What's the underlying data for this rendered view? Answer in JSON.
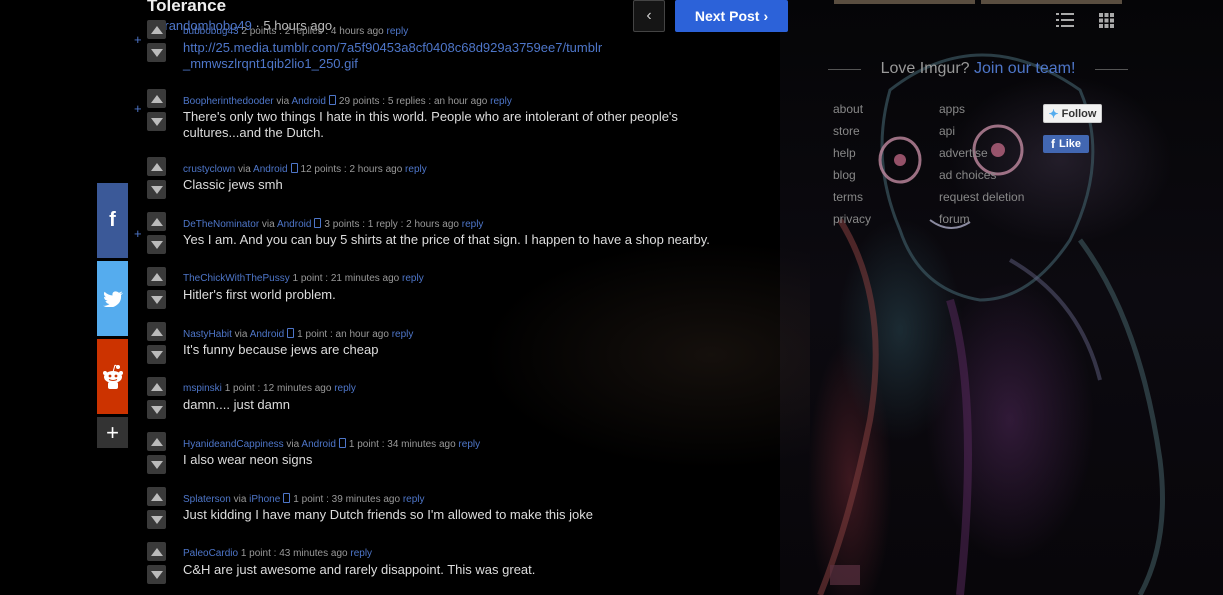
{
  "post": {
    "title": "Tolerance",
    "by": "by",
    "author": "randomhobo49",
    "age": " · 5 hours ago"
  },
  "nav": {
    "prev_glyph": "‹",
    "next_label": "Next Post"
  },
  "share": {
    "facebook_glyph": "f",
    "more_glyph": "+"
  },
  "comments": [
    {
      "user": "bubbobug43",
      "platform": "",
      "points": "2 points",
      "replies": " : 2 replies",
      "age": " : 4 hours ago",
      "reply": "reply",
      "text": "",
      "link": "http://25.media.tumblr.com/7a5f90453a8cf0408c68d929a3759ee7/tumblr_mmwszlrqnt1qib2lio1_250.gif",
      "expand": "+"
    },
    {
      "user": "Boopherinthedooder",
      "platform": "Android",
      "points": "29 points",
      "replies": " : 5 replies",
      "age": " : an hour ago",
      "reply": "reply",
      "text": "There's only two things I hate in this world. People who are intolerant of other people's cultures...and the Dutch.",
      "expand": "+"
    },
    {
      "user": "crustyclown",
      "platform": "Android",
      "points": "12 points",
      "replies": "",
      "age": " : 2 hours ago",
      "reply": "reply",
      "text": "Classic jews smh",
      "expand": ""
    },
    {
      "user": "DeTheNominator",
      "platform": "Android",
      "points": "3 points",
      "replies": " : 1 reply",
      "age": " : 2 hours ago",
      "reply": "reply",
      "text": "Yes I am. And you can buy 5 shirts at the price of that sign. I happen to have a shop nearby.",
      "expand": "+"
    },
    {
      "user": "TheChickWithThePussy",
      "platform": "",
      "points": "1 point",
      "replies": "",
      "age": " : 21 minutes ago",
      "reply": "reply",
      "text": "Hitler's first world problem.",
      "expand": ""
    },
    {
      "user": "NastyHabit",
      "platform": "Android",
      "points": "1 point",
      "replies": "",
      "age": " : an hour ago",
      "reply": "reply",
      "text": "It's funny because jews are cheap",
      "expand": ""
    },
    {
      "user": "mspinski",
      "platform": "",
      "points": "1 point",
      "replies": "",
      "age": " : 12 minutes ago",
      "reply": "reply",
      "text": "damn.... just damn",
      "expand": ""
    },
    {
      "user": "HyanideandCappiness",
      "platform": "Android",
      "points": "1 point",
      "replies": "",
      "age": " : 34 minutes ago",
      "reply": "reply",
      "text": "I also wear neon signs",
      "expand": ""
    },
    {
      "user": "Splaterson",
      "platform": "iPhone",
      "points": "1 point",
      "replies": "",
      "age": " : 39 minutes ago",
      "reply": "reply",
      "text": "Just kidding I have many Dutch friends so I'm allowed to make this joke",
      "expand": ""
    },
    {
      "user": "PaleoCardio",
      "platform": "",
      "points": "1 point",
      "replies": "",
      "age": " : 43 minutes ago",
      "reply": "reply",
      "text": "C&H are just awesome and rarely disappoint. This was great.",
      "expand": ""
    }
  ],
  "sidebar": {
    "love_text": "Love Imgur?",
    "join_text": "Join our team!",
    "links_col1": [
      "about",
      "store",
      "help",
      "blog",
      "terms",
      "privacy"
    ],
    "links_col2": [
      "apps",
      "api",
      "advertise",
      "ad choices",
      "request deletion",
      "forum"
    ],
    "twitter_follow": "Follow",
    "facebook_like": "Like"
  }
}
